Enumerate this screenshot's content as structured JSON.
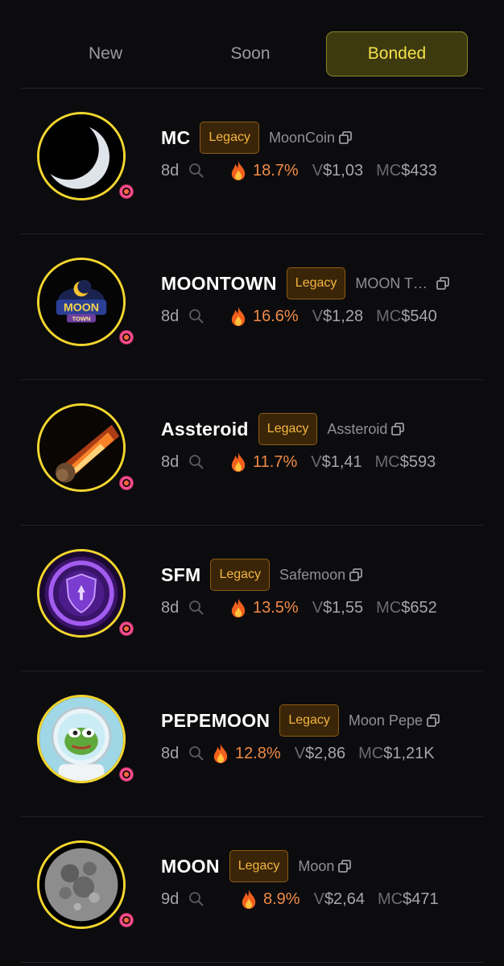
{
  "tabs": [
    {
      "label": "New",
      "active": false
    },
    {
      "label": "Soon",
      "active": false
    },
    {
      "label": "Bonded",
      "active": true
    }
  ],
  "colors": {
    "active_tab_text": "#f4e14b",
    "avatar_ring": "#f3d62e",
    "legacy_text": "#f5b640",
    "pct_text": "#f08a47"
  },
  "tokens": [
    {
      "ticker": "MC",
      "badge": "Legacy",
      "name": "MoonCoin",
      "age": "8d",
      "pct": "18.7%",
      "v_label": "V",
      "v": "$1,03",
      "mc_label": "MC",
      "mc": "$433"
    },
    {
      "ticker": "MOONTOWN",
      "badge": "Legacy",
      "name": "MOON T…",
      "age": "8d",
      "pct": "16.6%",
      "v_label": "V",
      "v": "$1,28",
      "mc_label": "MC",
      "mc": "$540",
      "logo_text_1": "MOON",
      "logo_text_2": "TOWN"
    },
    {
      "ticker": "Assteroid",
      "badge": "Legacy",
      "name": "Assteroid",
      "age": "8d",
      "pct": "11.7%",
      "v_label": "V",
      "v": "$1,41",
      "mc_label": "MC",
      "mc": "$593"
    },
    {
      "ticker": "SFM",
      "badge": "Legacy",
      "name": "Safemoon",
      "age": "8d",
      "pct": "13.5%",
      "v_label": "V",
      "v": "$1,55",
      "mc_label": "MC",
      "mc": "$652"
    },
    {
      "ticker": "PEPEMOON",
      "badge": "Legacy",
      "name": "Moon Pepe",
      "age": "8d",
      "pct": "12.8%",
      "v_label": "V",
      "v": "$2,86",
      "mc_label": "MC",
      "mc": "$1,21K"
    },
    {
      "ticker": "MOON",
      "badge": "Legacy",
      "name": "Moon",
      "age": "9d",
      "pct": "8.9%",
      "v_label": "V",
      "v": "$2,64",
      "mc_label": "MC",
      "mc": "$471"
    }
  ]
}
